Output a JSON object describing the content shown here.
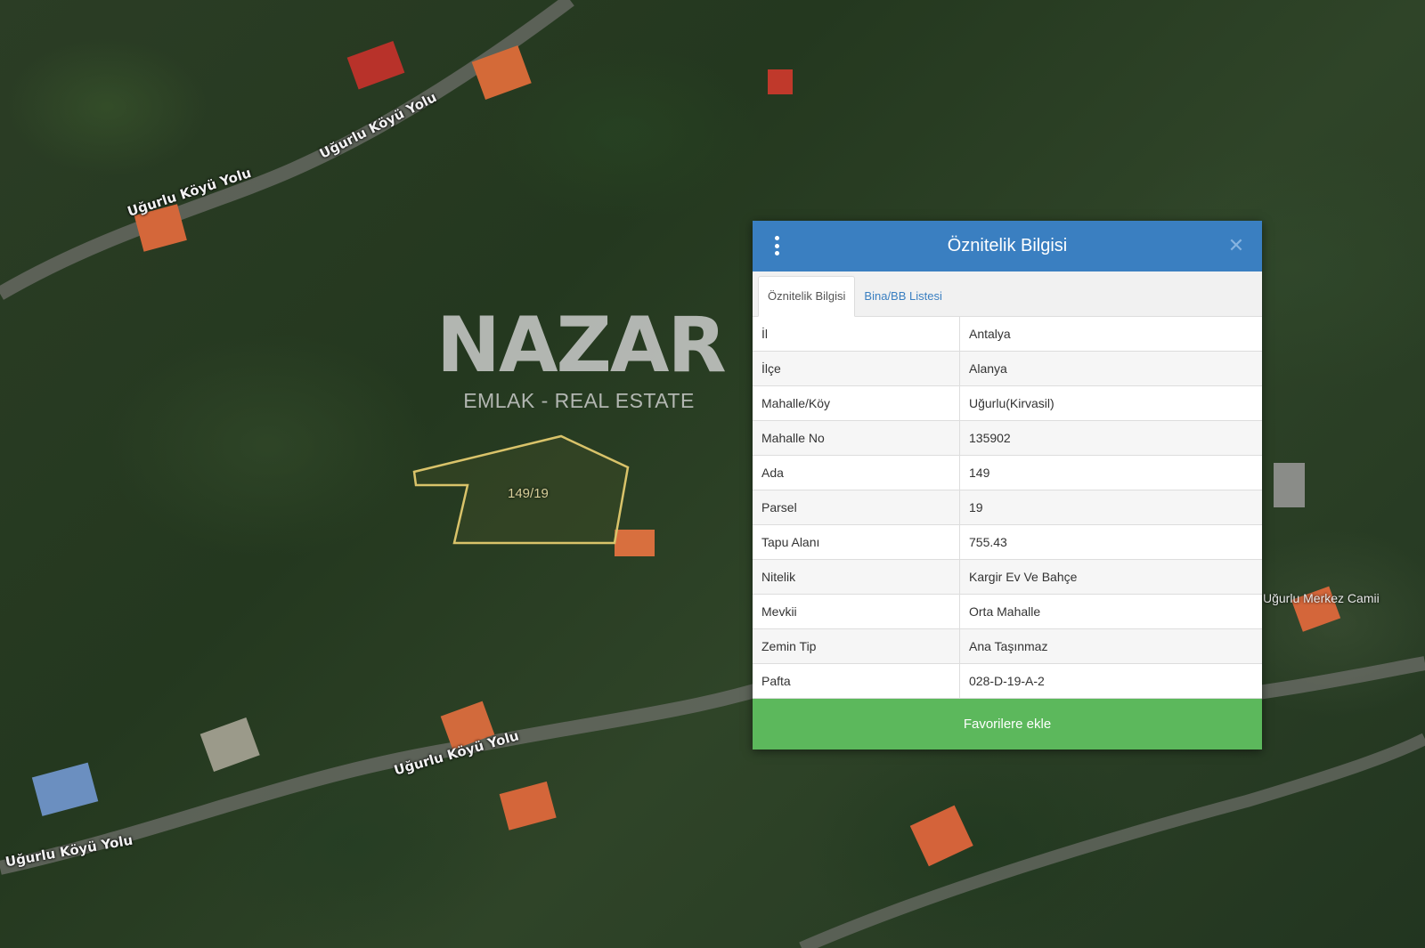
{
  "map": {
    "road_labels": [
      "Uğurlu Köyü Yolu",
      "Uğurlu Köyü Yolu",
      "Uğurlu Köyü Yolu",
      "Uğurlu Köyü Yolu"
    ],
    "poi_label": "Uğurlu Merkez Camii",
    "parcel_label": "149/19",
    "parcel_outline_color": "#d9c36a"
  },
  "watermark": {
    "logo": "NAZAR",
    "tagline": "EMLAK - REAL ESTATE"
  },
  "panel": {
    "title": "Öznitelik Bilgisi",
    "header_color": "#3a7fc1",
    "menu_icon": "vertical-ellipsis-icon",
    "close_icon": "close-icon",
    "close_symbol": "✕",
    "tabs": [
      {
        "label": "Öznitelik Bilgisi",
        "active": true
      },
      {
        "label": "Bina/BB Listesi",
        "active": false
      }
    ],
    "rows": [
      {
        "key": "İl",
        "value": "Antalya"
      },
      {
        "key": "İlçe",
        "value": "Alanya"
      },
      {
        "key": "Mahalle/Köy",
        "value": "Uğurlu(Kirvasil)"
      },
      {
        "key": "Mahalle No",
        "value": "135902"
      },
      {
        "key": "Ada",
        "value": "149"
      },
      {
        "key": "Parsel",
        "value": "19"
      },
      {
        "key": "Tapu Alanı",
        "value": "755.43"
      },
      {
        "key": "Nitelik",
        "value": "Kargir Ev Ve Bahçe"
      },
      {
        "key": "Mevkii",
        "value": "Orta Mahalle"
      },
      {
        "key": "Zemin Tip",
        "value": "Ana Taşınmaz"
      },
      {
        "key": "Pafta",
        "value": "028-D-19-A-2"
      }
    ],
    "favorite_button": "Favorilere ekle",
    "favorite_color": "#5cb85c"
  }
}
